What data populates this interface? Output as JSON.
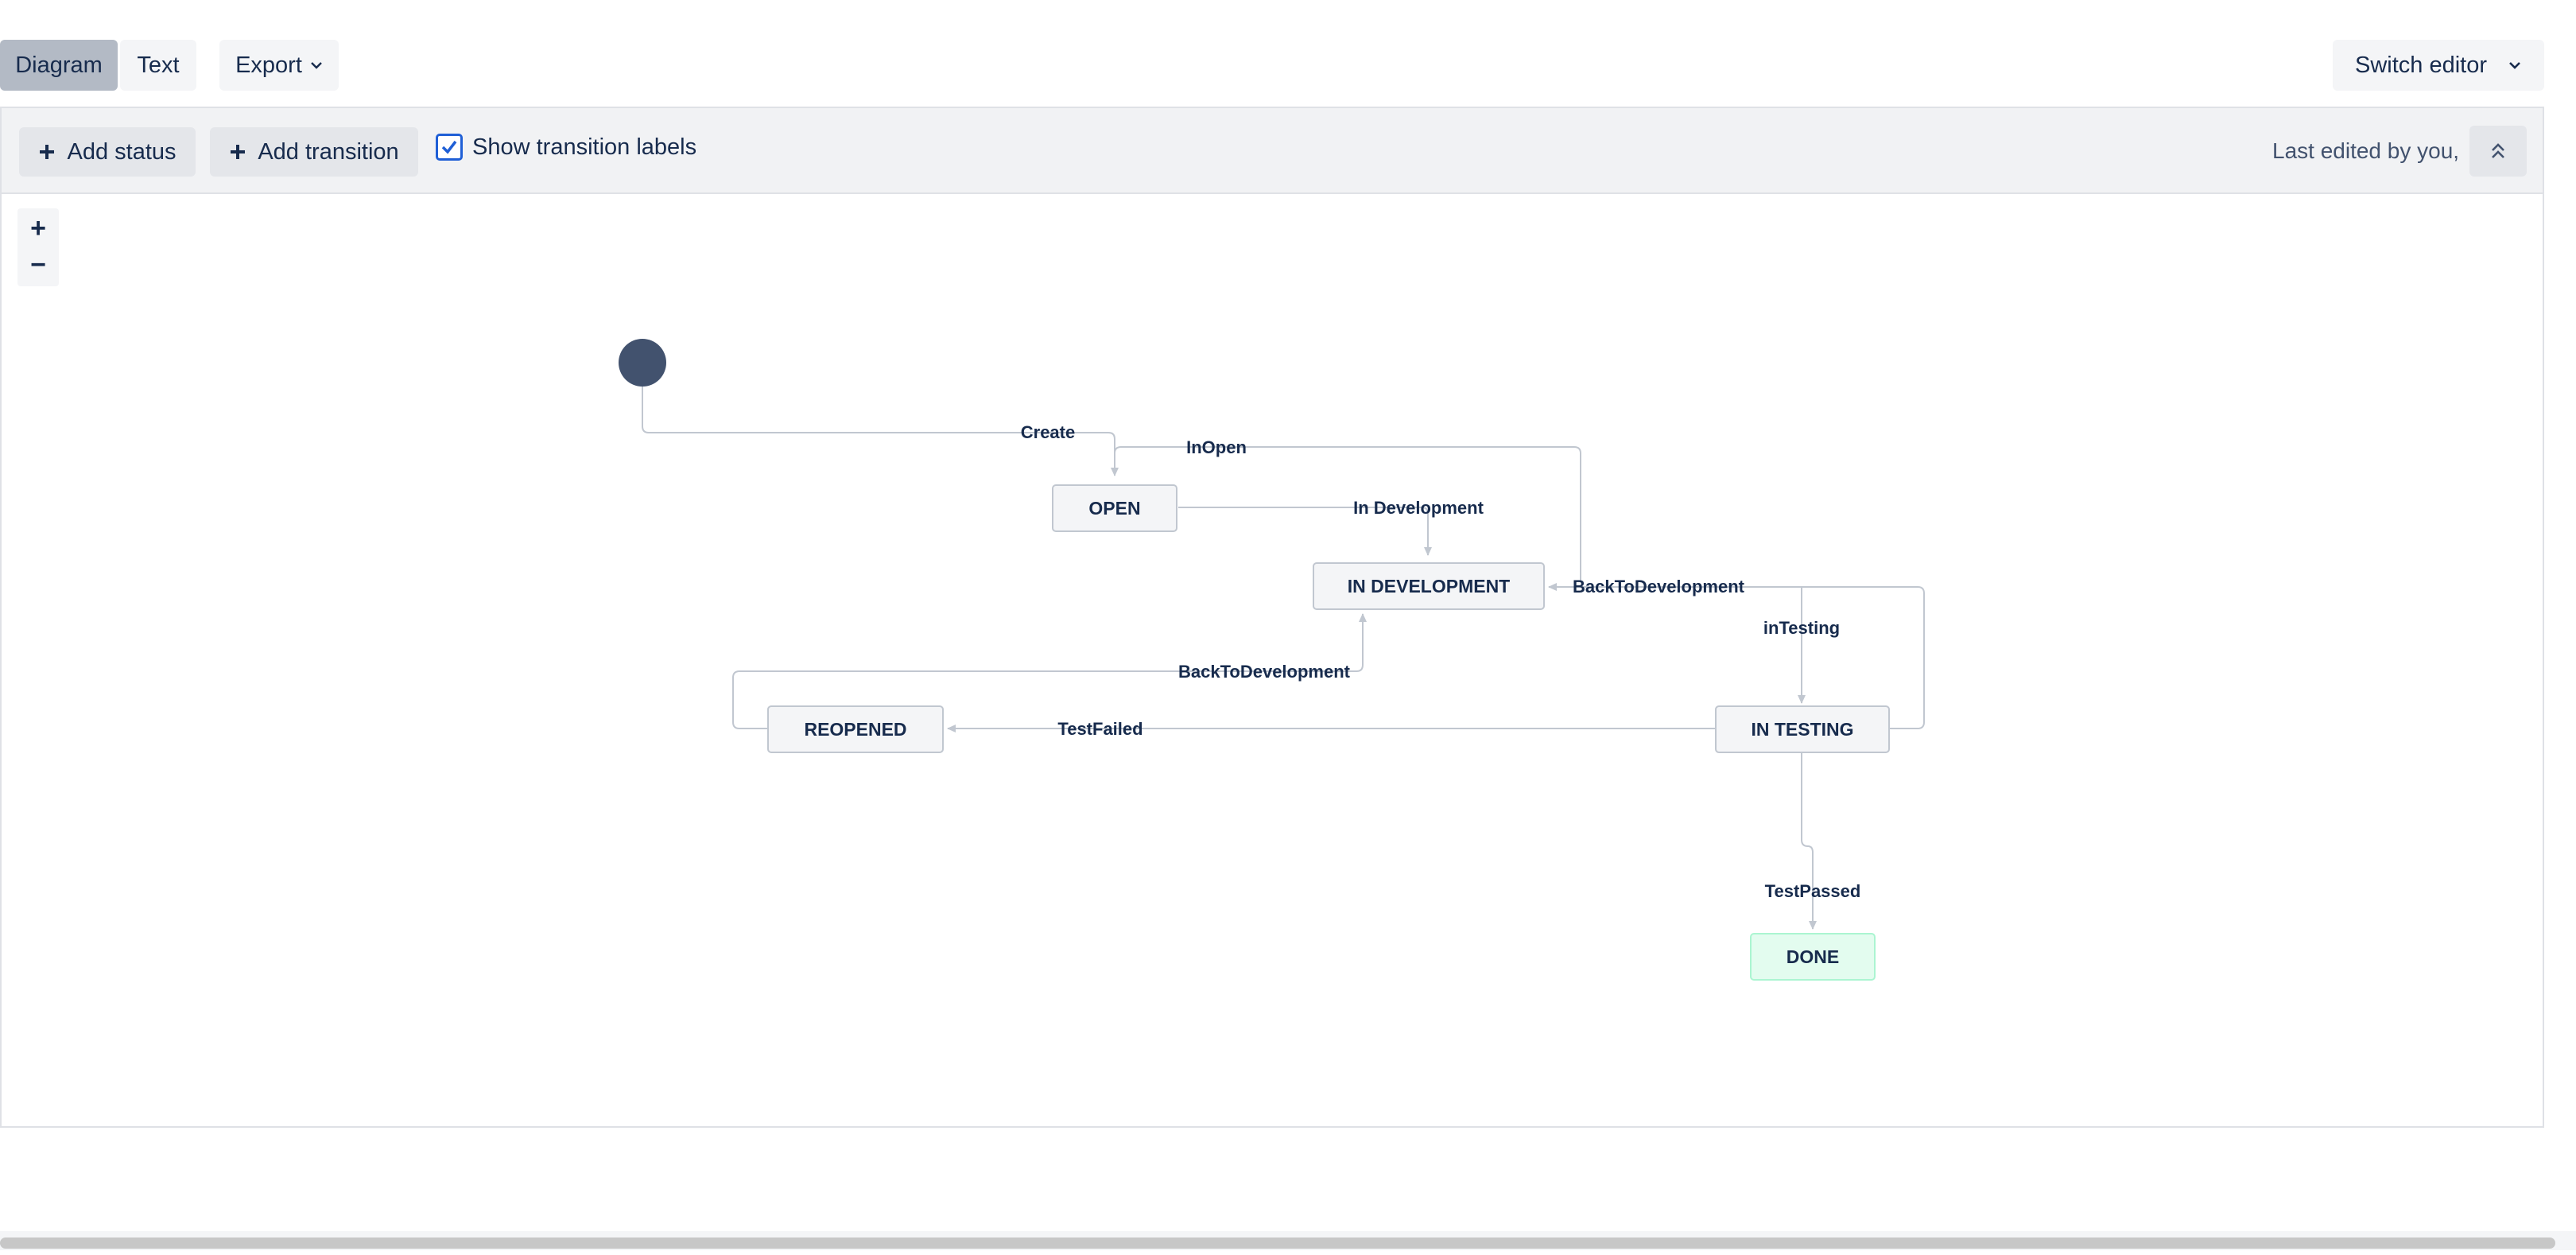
{
  "tabs": {
    "diagram": "Diagram",
    "text": "Text"
  },
  "export_label": "Export",
  "switch_editor_label": "Switch editor",
  "toolbar": {
    "add_status": "Add status",
    "add_transition": "Add transition",
    "show_labels": "Show transition labels",
    "show_labels_checked": true,
    "last_edited": "Last edited by you,"
  },
  "zoom": {
    "in": "+",
    "out": "−"
  },
  "statuses": {
    "open": "OPEN",
    "in_development": "IN DEVELOPMENT",
    "reopened": "REOPENED",
    "in_testing": "IN TESTING",
    "done": "DONE"
  },
  "transitions": {
    "create": "Create",
    "in_open": "InOpen",
    "in_development": "In Development",
    "back_to_development_testing": "BackToDevelopment",
    "in_testing": "inTesting",
    "back_to_development_reopened": "BackToDevelopment",
    "test_failed": "TestFailed",
    "test_passed": "TestPassed"
  },
  "colors": {
    "start_node": "#42526e",
    "status_fill": "#f4f5f7",
    "status_border": "#c1c7d0",
    "done_fill": "#e3fcef",
    "done_border": "#abf5d1",
    "accent": "#1f5fd6"
  },
  "icons": {
    "plus": "plus-icon",
    "chevron": "chevron-down-icon",
    "collapse": "double-chevron-up-icon",
    "checkbox": "check-icon"
  }
}
